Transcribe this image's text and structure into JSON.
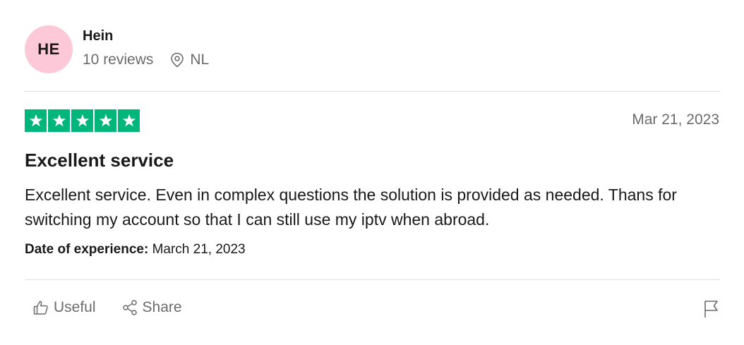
{
  "reviewer": {
    "initials": "HE",
    "name": "Hein",
    "review_count": "10 reviews",
    "location": "NL",
    "avatar_color": "#fdc9d8"
  },
  "review": {
    "rating": 5,
    "max_rating": 5,
    "star_color": "#00b67a",
    "date": "Mar 21, 2023",
    "title": "Excellent service",
    "body": "Excellent service. Even in complex questions the solution is provided as needed. Thans for switching my account so that I can still use my iptv when abroad.",
    "experience_label": "Date of experience:",
    "experience_date": "March 21, 2023"
  },
  "actions": {
    "useful_label": "Useful",
    "share_label": "Share",
    "useful_icon": "thumbs-up-icon",
    "share_icon": "share-icon",
    "report_icon": "flag-icon"
  }
}
